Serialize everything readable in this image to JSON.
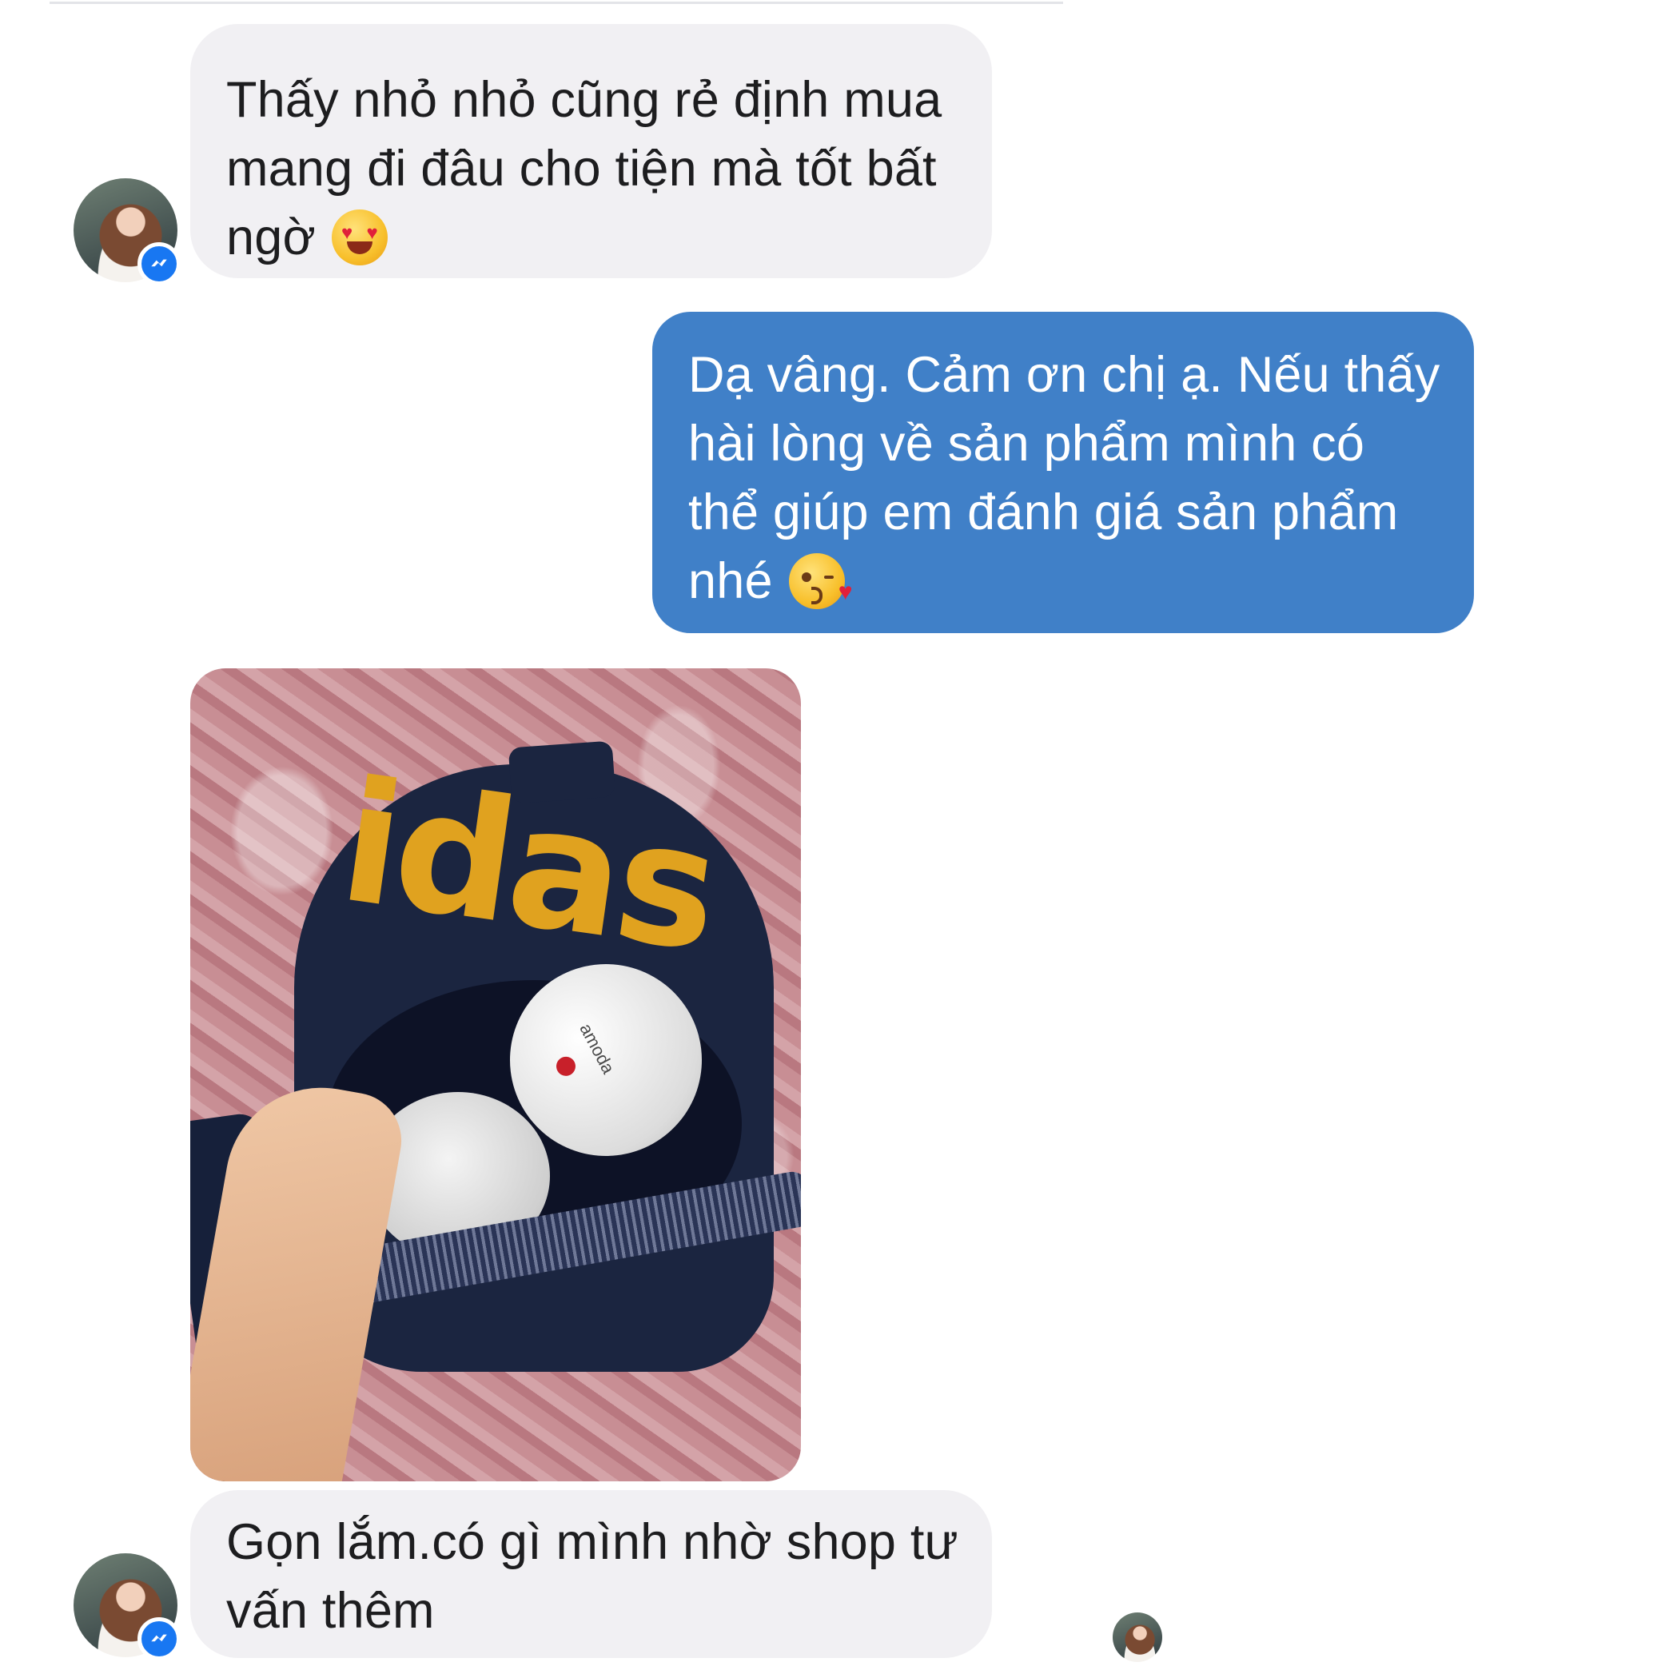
{
  "messages": [
    {
      "id": "msg1",
      "direction": "incoming",
      "lines": [
        "Thấy nhỏ nhỏ cũng rẻ định mua",
        "mang đi đâu cho tiện mà tốt bất",
        "ngờ"
      ],
      "emoji": "heart-eyes-emoji"
    },
    {
      "id": "msg2",
      "direction": "outgoing",
      "lines": [
        "Dạ vâng. Cảm ơn chị ạ. Nếu thấy",
        "hài lòng về sản phẩm mình có",
        "thể giúp em đánh giá sản phẩm",
        "nhé"
      ],
      "emoji": "kissing-heart-emoji"
    },
    {
      "id": "photo",
      "direction": "incoming",
      "type": "image",
      "bag_logo_text": "idas",
      "cup_label_text": "amoda"
    },
    {
      "id": "msg3",
      "direction": "incoming",
      "lines": [
        "Gọn lắm.có gì mình nhờ shop tư",
        "vấn thêm"
      ]
    }
  ],
  "icons": {
    "avatar_badge": "messenger-icon",
    "seen_indicator": "seen-avatar"
  },
  "colors": {
    "incoming_bubble": "#f1f0f3",
    "outgoing_bubble": "#4080c8",
    "badge": "#1877f2"
  }
}
